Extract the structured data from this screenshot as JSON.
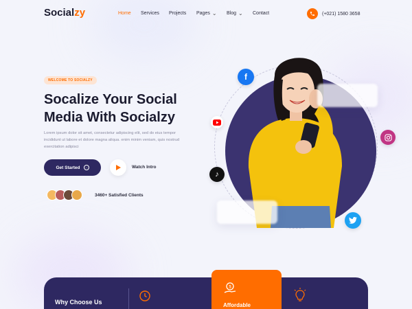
{
  "brand": {
    "logo_text": "Social",
    "logo_accent": "zy",
    "accent_color": "#ff6d00",
    "dark_color": "#2e2861"
  },
  "nav": {
    "items": [
      {
        "label": "Home",
        "active": true,
        "dropdown": false
      },
      {
        "label": "Services",
        "active": false,
        "dropdown": false
      },
      {
        "label": "Projects",
        "active": false,
        "dropdown": false
      },
      {
        "label": "Pages",
        "active": false,
        "dropdown": true
      },
      {
        "label": "Blog",
        "active": false,
        "dropdown": true
      },
      {
        "label": "Contact",
        "active": false,
        "dropdown": false
      }
    ]
  },
  "header": {
    "phone": "(+021) 1580 3658",
    "phone_icon": "phone-icon"
  },
  "hero": {
    "badge": "WELCOME TO SOCIALZY",
    "title": "Socalize Your Social Media With Socialzy",
    "description": "Lorem ipsum dolor sit amet, consectetur adipiscing elit, sed do eius tempor incididunt ut labore et dolore magna aliqua. enim minim veniam, quis nostrud exercitation adipisci",
    "cta_label": "Get Started",
    "watch_label": "Watch Intro",
    "clients_label": "3460+ Satisfied Clients",
    "avatar_colors": [
      "#f4b860",
      "#b85b5b",
      "#6b4a3a",
      "#e8a84a"
    ]
  },
  "socials": [
    "facebook-icon",
    "youtube-icon",
    "tiktok-icon",
    "instagram-icon",
    "twitter-icon"
  ],
  "why": {
    "title": "Why Choose Us",
    "card_label": "Affordable"
  }
}
